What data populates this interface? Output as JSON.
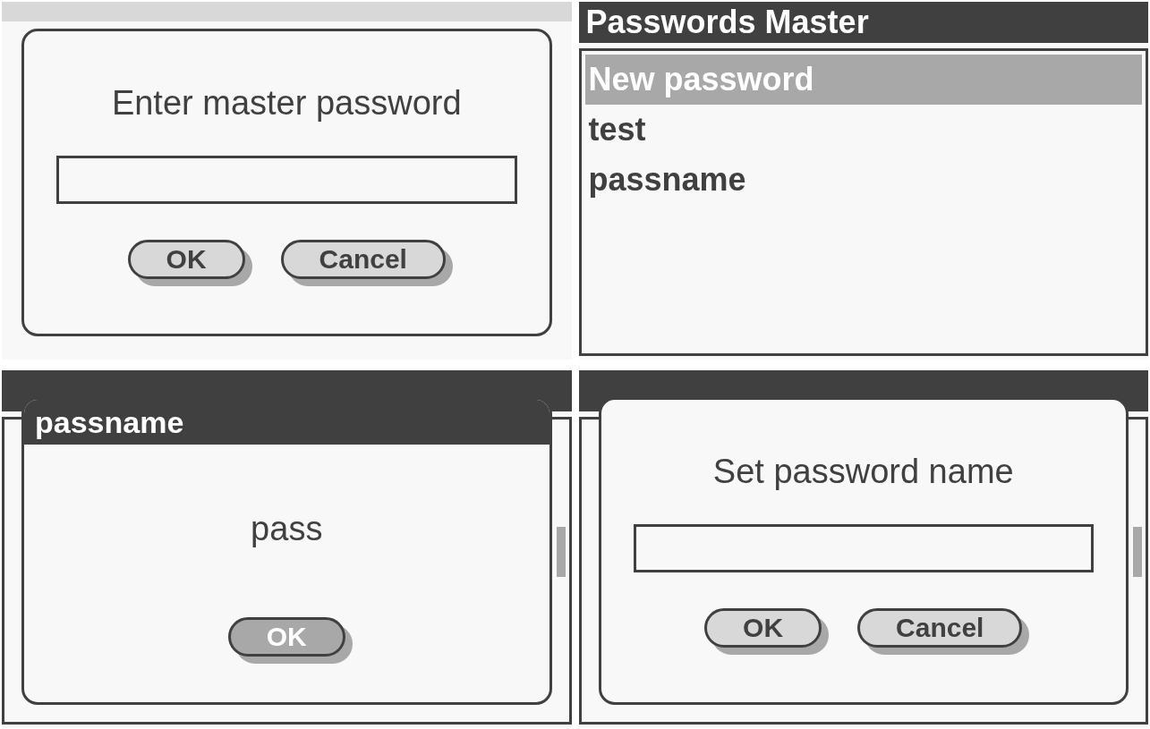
{
  "panels": [
    {
      "kind": "launcher",
      "dialog": {
        "kind": "prompt",
        "message": "Enter master password",
        "buttons": [
          {
            "label": "OK",
            "pressed": false
          },
          {
            "label": "Cancel",
            "pressed": false
          }
        ]
      }
    },
    {
      "kind": "list",
      "title": "Passwords Master",
      "items": [
        {
          "label": "New password",
          "selected": true
        },
        {
          "label": "test",
          "selected": false
        },
        {
          "label": "passname",
          "selected": false
        }
      ]
    },
    {
      "kind": "list",
      "dialog": {
        "kind": "alert",
        "title": "passname",
        "message": "pass",
        "buttons": [
          {
            "label": "OK",
            "pressed": true
          }
        ]
      }
    },
    {
      "kind": "list",
      "dialog": {
        "kind": "prompt",
        "message": "Set password name",
        "buttons": [
          {
            "label": "OK",
            "pressed": false
          },
          {
            "label": "Cancel",
            "pressed": false
          }
        ]
      }
    }
  ]
}
